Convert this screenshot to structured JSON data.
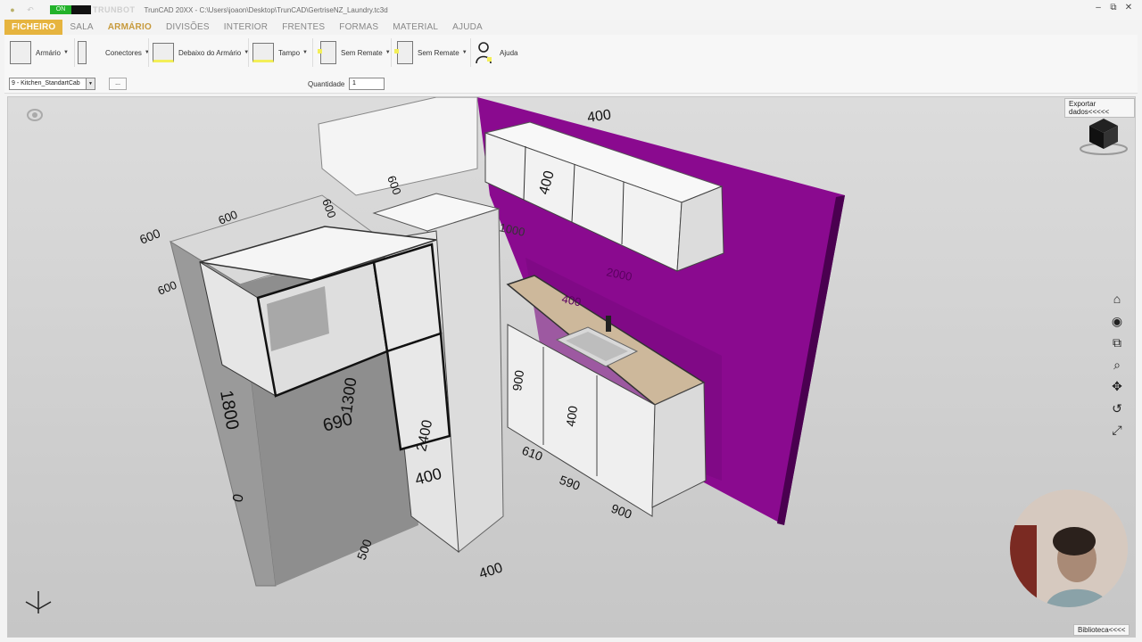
{
  "titlebar": {
    "on_label": "ON",
    "brand": "TRUNBOT",
    "title": "TrunCAD 20XX - C:\\Users\\joaon\\Desktop\\TrunCAD\\GertriseNZ_Laundry.tc3d",
    "minimize": "–",
    "restore": "⧉",
    "close": "✕"
  },
  "menu": [
    {
      "label": "FICHEIRO"
    },
    {
      "label": "SALA"
    },
    {
      "label": "ARMÁRIO"
    },
    {
      "label": "DIVISÕES"
    },
    {
      "label": "INTERIOR"
    },
    {
      "label": "FRENTES"
    },
    {
      "label": "FORMAS"
    },
    {
      "label": "MATERIAL"
    },
    {
      "label": "AJUDA"
    }
  ],
  "ribbon": {
    "buttons": [
      {
        "label": "Armário",
        "icon": "cabinet-icon"
      },
      {
        "label": "Conectores",
        "icon": "connector-icon"
      },
      {
        "label": "Debaixo do Armário",
        "icon": "under-cabinet-icon"
      },
      {
        "label": "Tampo",
        "icon": "top-panel-icon"
      },
      {
        "label": "Sem Remate",
        "icon": "no-trim-left-icon"
      },
      {
        "label": "Sem Remate",
        "icon": "no-trim-right-icon"
      },
      {
        "label": "Ajuda",
        "icon": "help-person-icon"
      }
    ],
    "cabinet_select": "9 - Kitchen_StandartCab",
    "more_button": "...",
    "quantity_label": "Quantidade",
    "quantity_value": "1"
  },
  "viewport": {
    "export_button": "Exportar dados<<<<<",
    "library_button": "Biblioteca<<<<",
    "dimension_labels": [
      "400",
      "400",
      "600",
      "600",
      "600",
      "600",
      "600",
      "1300",
      "690",
      "2400",
      "400",
      "1800",
      "0",
      "500",
      "400",
      "610",
      "590",
      "900",
      "900",
      "400",
      "1000",
      "2000",
      "400"
    ],
    "wall_color": "#8a0a8f",
    "countertop_color": "#cdb89b"
  },
  "tools": [
    "home-icon",
    "view-icon",
    "zoom-window-icon",
    "zoom-icon",
    "pan-icon",
    "rotate-icon",
    "fit-icon"
  ]
}
